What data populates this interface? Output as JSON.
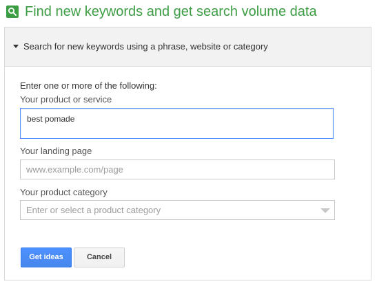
{
  "header": {
    "title": "Find new keywords and get search volume data",
    "icon": "search-icon"
  },
  "panel": {
    "header_label": "Search for new keywords using a phrase, website or category",
    "intro": "Enter one or more of the following:",
    "product": {
      "label": "Your product or service",
      "value": "best pomade"
    },
    "landing": {
      "label": "Your landing page",
      "placeholder": "www.example.com/page"
    },
    "category": {
      "label": "Your product category",
      "placeholder": "Enter or select a product category"
    },
    "buttons": {
      "primary": "Get ideas",
      "secondary": "Cancel"
    }
  },
  "colors": {
    "brand_green": "#3c9d43",
    "primary_blue": "#4d90fe",
    "panel_header_bg": "#f2f2f2"
  }
}
